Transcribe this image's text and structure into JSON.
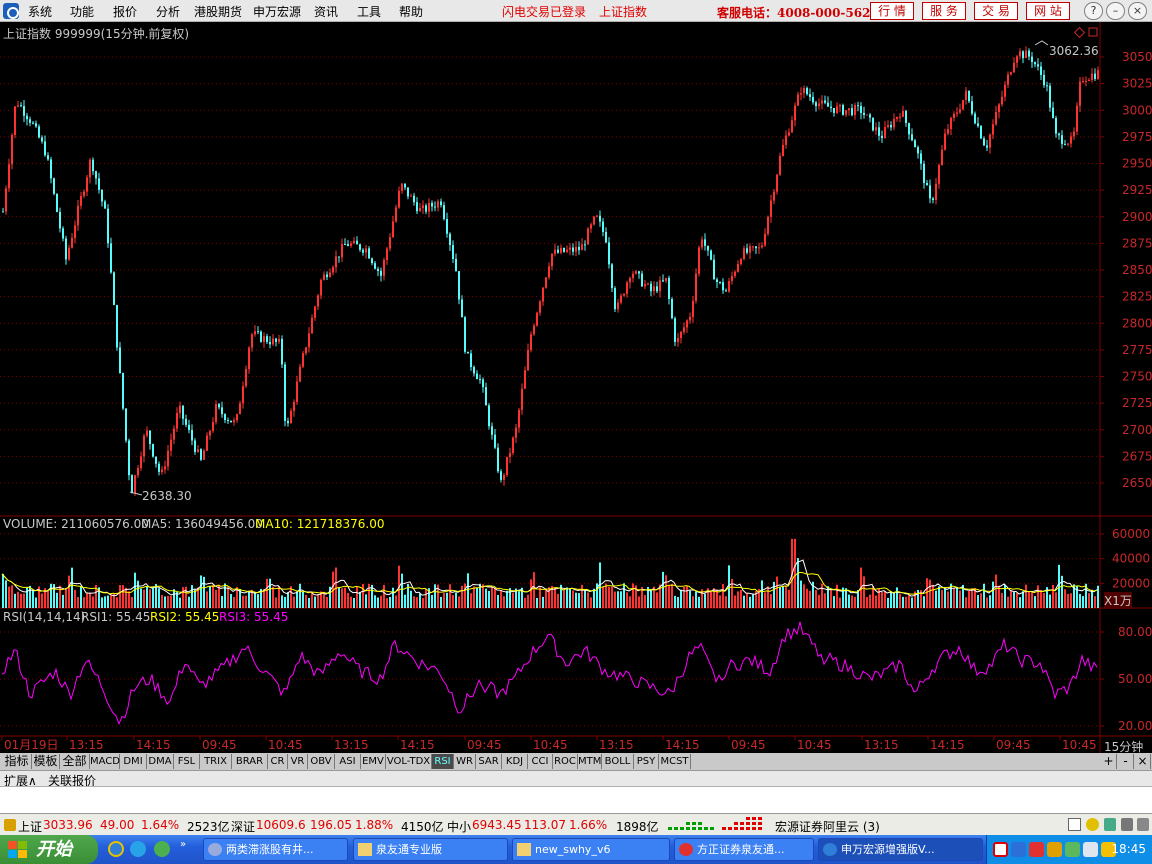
{
  "menubar": {
    "items": [
      "系统",
      "功能",
      "报价",
      "分析",
      "港股期货",
      "申万宏源",
      "资讯",
      "工具",
      "帮助"
    ],
    "status_login": "闪电交易已登录",
    "status_index": "上证指数",
    "hotline": "客服电话：4008-000-562",
    "quick_buttons": [
      "行 情",
      "服 务",
      "交 易",
      "网 站"
    ]
  },
  "chart": {
    "title": "上证指数 999999(15分钟.前复权)",
    "high_label": "3062.36",
    "low_label": "2638.30",
    "price_axis": [
      "3050",
      "3025",
      "3000",
      "2975",
      "2950",
      "2925",
      "2900",
      "2875",
      "2850",
      "2825",
      "2800",
      "2775",
      "2750",
      "2725",
      "2700",
      "2675",
      "2650"
    ],
    "volume": {
      "label_volume": "VOLUME: 211060576.00",
      "label_ma5": "MA5: 136049456.00",
      "label_ma10": "MA10: 121718376.00",
      "axis": [
        "60000",
        "40000",
        "20000"
      ],
      "unit": "X1万"
    },
    "rsi": {
      "label_main": "RSI(14,14,14)",
      "label_rsi1": "RSI1: 55.45",
      "label_rsi2": "RSI2: 55.45",
      "label_rsi3": "RSI3: 55.45",
      "axis": [
        "80.00",
        "50.00",
        "20.00"
      ]
    },
    "time_axis": [
      "01月19日",
      "13:15",
      "14:15",
      "09:45",
      "10:45",
      "13:15",
      "14:15",
      "09:45",
      "10:45",
      "13:15",
      "14:15",
      "09:45",
      "10:45",
      "13:15",
      "14:15",
      "09:45",
      "10:45"
    ],
    "period": "15分钟",
    "colors": {
      "up": "#ff3232",
      "down": "#54fcfc",
      "grid": "#800000",
      "rsi": "#ff00ff",
      "ma5": "#ffffff",
      "ma10": "#ffff00"
    }
  },
  "indicator_tabs": [
    "指标",
    "模板",
    "全部",
    "MACD",
    "DMI",
    "DMA",
    "FSL",
    "TRIX",
    "BRAR",
    "CR",
    "VR",
    "OBV",
    "ASI",
    "EMV",
    "VOL-TDX",
    "RSI",
    "WR",
    "SAR",
    "KDJ",
    "CCI",
    "ROC",
    "MTM",
    "BOLL",
    "PSY",
    "MCST"
  ],
  "active_indicator": "RSI",
  "zoom_buttons": [
    "+",
    "-",
    "×"
  ],
  "ext_row": [
    "扩展∧",
    "关联报价"
  ],
  "status_bar": {
    "sh_name": "上证",
    "sh_value": "3033.96",
    "sh_change": "49.00",
    "sh_pct": "1.64%",
    "sh_amount": "2523亿",
    "sz_name": "深证",
    "sz_value": "10609.6",
    "sz_change": "196.05",
    "sz_pct": "1.88%",
    "sz_amount": "4150亿",
    "zx_name": "中小",
    "zx_value": "6943.45",
    "zx_change": "113.07",
    "zx_pct": "1.66%",
    "zx_amount": "1898亿",
    "broker": "宏源证券阿里云 (3)"
  },
  "taskbar": {
    "start": "开始",
    "tasks": [
      "两类滞涨股有井...",
      "泉友通专业版",
      "new_swhy_v6",
      "方正证券泉友通...",
      "申万宏源增强版V..."
    ],
    "clock": "18:45"
  }
}
